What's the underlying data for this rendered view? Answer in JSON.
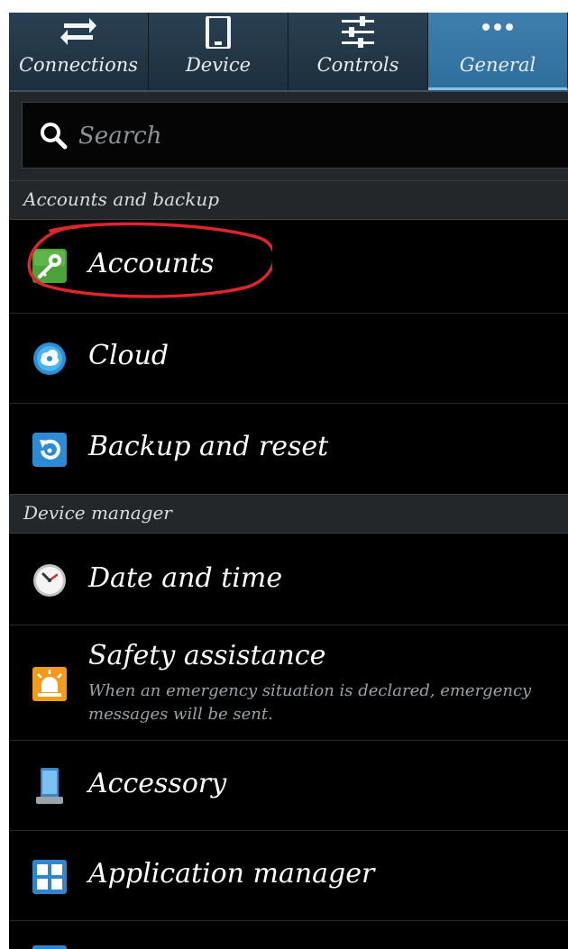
{
  "tabs": [
    {
      "label": "Connections",
      "icon": "swap-arrows-icon",
      "active": false
    },
    {
      "label": "Device",
      "icon": "phone-icon",
      "active": false
    },
    {
      "label": "Controls",
      "icon": "sliders-icon",
      "active": false
    },
    {
      "label": "General",
      "icon": "more-dots-icon",
      "active": true
    }
  ],
  "search": {
    "placeholder": "Search",
    "value": ""
  },
  "sections": [
    {
      "title": "Accounts and backup"
    },
    {
      "title": "Device manager"
    }
  ],
  "items": [
    {
      "label": "Accounts",
      "icon": "key-icon",
      "highlighted": true
    },
    {
      "label": "Cloud",
      "icon": "cloud-sync-icon"
    },
    {
      "label": "Backup and reset",
      "icon": "backup-reset-icon"
    },
    {
      "label": "Date and time",
      "icon": "clock-icon"
    },
    {
      "label": "Safety assistance",
      "subtitle": "When an emergency situation is declared, emergency messages will be sent.",
      "icon": "siren-icon"
    },
    {
      "label": "Accessory",
      "icon": "accessory-icon"
    },
    {
      "label": "Application manager",
      "icon": "app-grid-icon"
    }
  ],
  "colors": {
    "tab_bar": "#1d2f3d",
    "tab_active": "#2f6f9e",
    "section_header": "#23272a",
    "annotation": "#e0242a"
  }
}
